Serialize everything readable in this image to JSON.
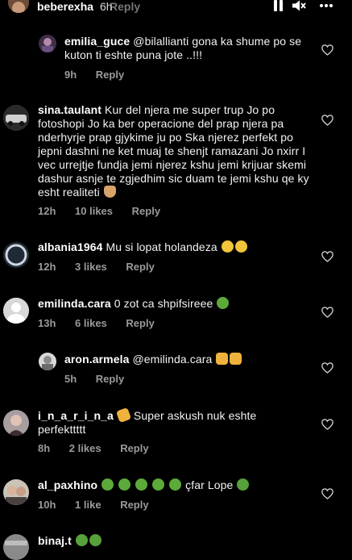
{
  "story_header": {
    "username": "beberexha",
    "time": "6h",
    "reply_label": "Reply"
  },
  "comments": [
    {
      "username": "emilia_guce",
      "text": "@bilallianti gona ka shume po se kuton ti eshte puna jote ..!!!",
      "time": "9h",
      "likes": "",
      "reply": "Reply"
    },
    {
      "username": "sina.taulant",
      "text": "Kur del njera me super trup Jo po fotoshopi Jo ka ber operacione del prap njera pa nderhyrje prap gjykime ju po Ska njerez perfekt po jepni dashni ne ket muaj te shenjt ramazani Jo nxirr I vec urrejtje fundja jemi njerez kshu jemi krijuar skemi dashur asnje te zgjedhim sic duam te jemi kshu qe ky esht realiteti",
      "time": "12h",
      "likes": "10 likes",
      "reply": "Reply"
    },
    {
      "username": "albania1964",
      "text": "Mu si lopat holandeza",
      "time": "12h",
      "likes": "3 likes",
      "reply": "Reply"
    },
    {
      "username": "emilinda.cara",
      "text": "0 zot ca shpifsireee",
      "time": "13h",
      "likes": "6 likes",
      "reply": "Reply"
    },
    {
      "username": "aron.armela",
      "text": "@emilinda.cara",
      "time": "5h",
      "likes": "",
      "reply": "Reply"
    },
    {
      "username": "i_n_a_r_i_n_a",
      "text": "Super askush nuk eshte perfekttttt",
      "time": "8h",
      "likes": "2 likes",
      "reply": "Reply"
    },
    {
      "username": "al_paxhino",
      "text": "çfar Lope",
      "time": "10h",
      "likes": "1 like",
      "reply": "Reply"
    },
    {
      "username": "binaj.t",
      "text": "",
      "time": "",
      "likes": "",
      "reply": ""
    }
  ],
  "icons": {
    "heart": "heart-outline-icon",
    "pause": "pause-icon",
    "mute": "mute-icon",
    "more": "more-icon"
  }
}
